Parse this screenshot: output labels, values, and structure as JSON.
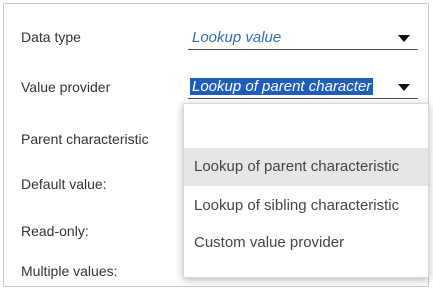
{
  "form": {
    "data_type_label": "Data type",
    "data_type_value": "Lookup value",
    "value_provider_label": "Value provider",
    "value_provider_value": "Lookup of parent character",
    "parent_characteristic_label": "Parent characteristic",
    "default_value_label": "Default value:",
    "read_only_label": "Read-only:",
    "multiple_values_label": "Multiple values:"
  },
  "dropdown": {
    "options": [
      "Lookup of parent characteristic",
      "Lookup of sibling characteristic",
      "Custom value provider"
    ],
    "hovered_index": 0
  },
  "icons": {
    "data_type_arrow": "caret-down-icon",
    "value_provider_arrow": "caret-down-icon"
  }
}
